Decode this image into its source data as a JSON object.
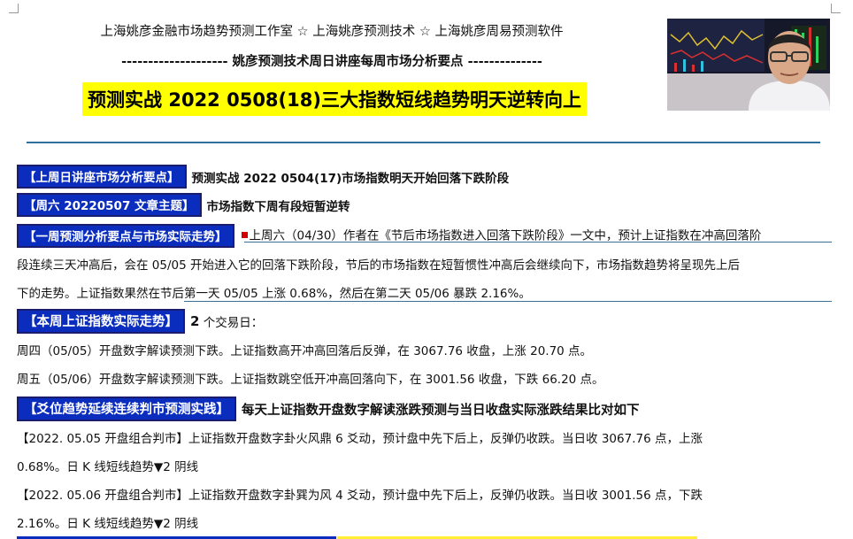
{
  "header": {
    "studio_line": "上海姚彦金融市场趋势预测工作室 ☆ 上海姚彦预测技术 ☆ 上海姚彦周易预测软件",
    "separator_line": "--------------------  姚彦预测技术周日讲座每周市场分析要点  --------------",
    "title": "预测实战 2022 0508(18)三大指数短线趋势明天逆转向上"
  },
  "sections": {
    "last_week": {
      "tag": "【上周日讲座市场分析要点】",
      "text": "预测实战 2022 0504(17)市场指数明天开始回落下跌阶段"
    },
    "saturday": {
      "tag": "【周六 20220507 文章主题】",
      "text": "市场指数下周有段短暂逆转"
    },
    "weekly_forecast": {
      "tag": "【一周预测分析要点与市场实际走势】",
      "line1": "上周六（04/30）作者在《节后市场指数进入回落下跌阶段》一文中，预计上证指数在冲高回落阶",
      "line2": "段连续三天冲高后，会在 05/05 开始进入它的回落下跌阶段，节后的市场指数在短暂惯性冲高后会继续向下，市场指数趋势将呈现先上后",
      "line3": "下的走势。上证指数果然在节后第一天 05/05 上涨 0.68%，然后在第二天 05/06 暴跌 2.16%。"
    },
    "this_week": {
      "tag": "【本周上证指数实际走势】",
      "count": "2",
      "count_suffix": " 个交易日：",
      "thu": "周四（05/05）开盘数字解读预测下跌。上证指数高开冲高回落后反弹，在 3067.76 收盘，上涨 20.70 点。",
      "fri": "周五（05/06）开盘数字解读预测下跌。上证指数跳空低开冲高回落向下，在 3001.56 收盘，下跌 66.20 点。"
    },
    "practice": {
      "tag": "【爻位趋势延续连续判市预测实践】",
      "text": "每天上证指数开盘数字解读涨跌预测与当日收盘实际涨跌结果比对如下",
      "entries": [
        {
          "line1": "【2022. 05.05 开盘组合判市】上证指数开盘数字卦火风鼎 6 爻动，预计盘中先下后上，反弹仍收跌。当日收 3067.76 点，上涨",
          "line2": "0.68%。日 K 线短线趋势▼2 阴线"
        },
        {
          "line1": "【2022. 05.06 开盘组合判市】上证指数开盘数字卦巽为风 4 爻动，预计盘中先下后上，反弹仍收跌。当日收 3001.56 点，下跌",
          "line2": "2.16%。日 K 线短线趋势▼2 阴线"
        }
      ]
    }
  },
  "colors": {
    "tag_bg": "#0a2dbe",
    "title_bg": "#ffff00",
    "rule": "#2f6f99",
    "bullet": "#d40000"
  }
}
